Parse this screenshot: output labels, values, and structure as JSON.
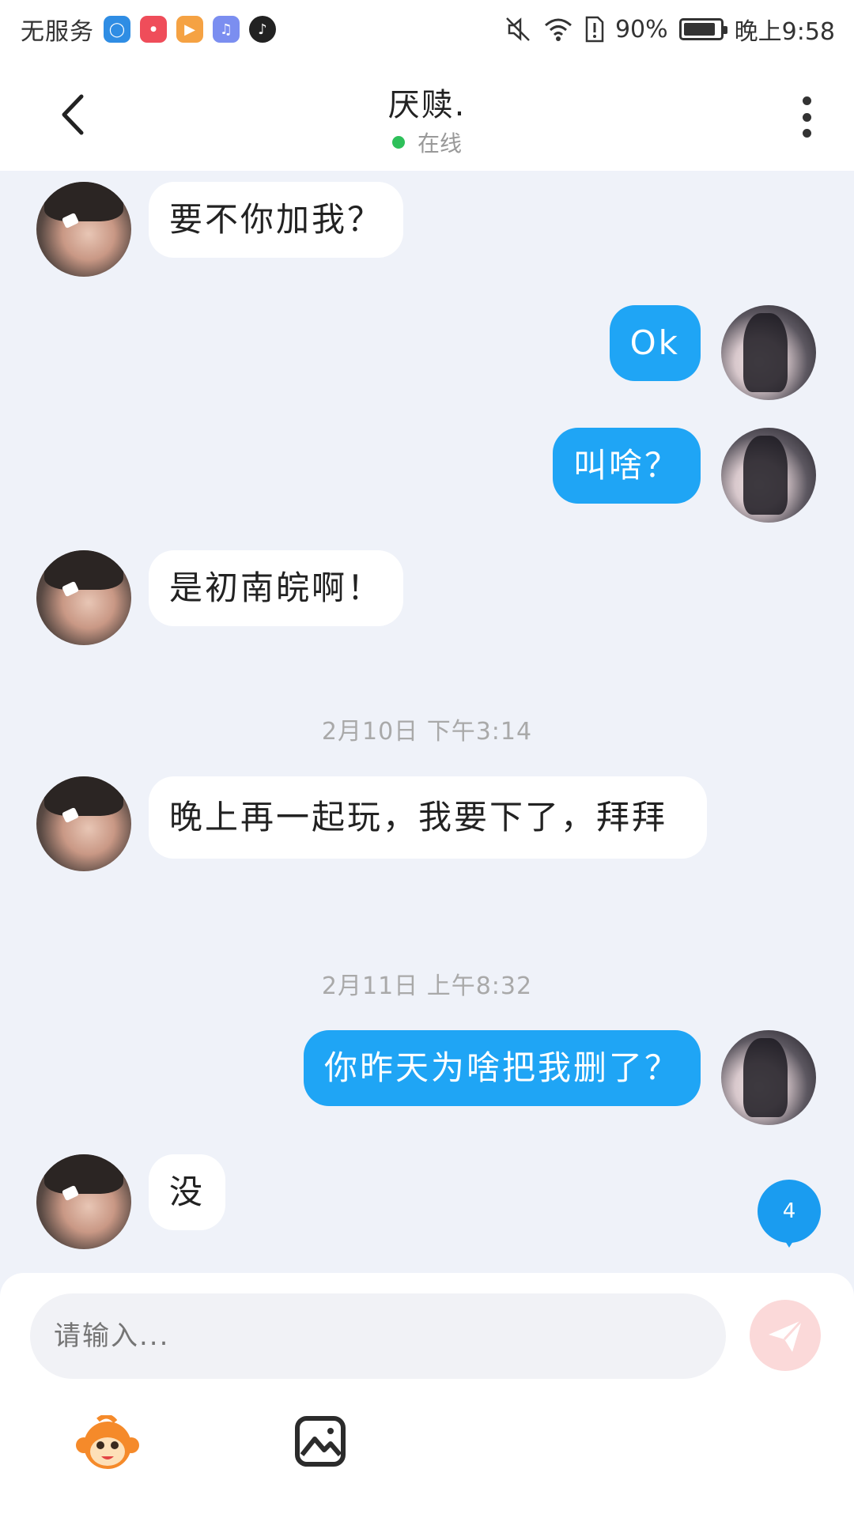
{
  "status_bar": {
    "carrier": "无服务",
    "battery_percent": "90%",
    "time": "晚上9:58",
    "battery_level": 0.9,
    "app_icons": [
      "shield-icon",
      "huawei-store-icon",
      "video-player-icon",
      "music-icon",
      "tiktok-icon"
    ]
  },
  "header": {
    "title": "厌赎.",
    "status": "在线"
  },
  "messages": [
    {
      "side": "in",
      "text": "要不你加我？"
    },
    {
      "side": "out",
      "text": "Ok"
    },
    {
      "side": "out",
      "text": "叫啥？"
    },
    {
      "side": "in",
      "text": "是初南皖啊！"
    },
    {
      "side": "in",
      "text": "晚上再一起玩，我要下了，拜拜"
    },
    {
      "side": "out",
      "text": "你昨天为啥把我删了？"
    },
    {
      "side": "in",
      "text": "没"
    }
  ],
  "timestamps": [
    "2月10日 下午3:14",
    "2月11日 上午8:32"
  ],
  "unread_badge": "4",
  "composer": {
    "placeholder": "请输入..."
  },
  "colors": {
    "accent": "#1fa5f5",
    "background": "#eff2f9",
    "online": "#2ec05a",
    "send_disabled": "#fbd9d9"
  }
}
